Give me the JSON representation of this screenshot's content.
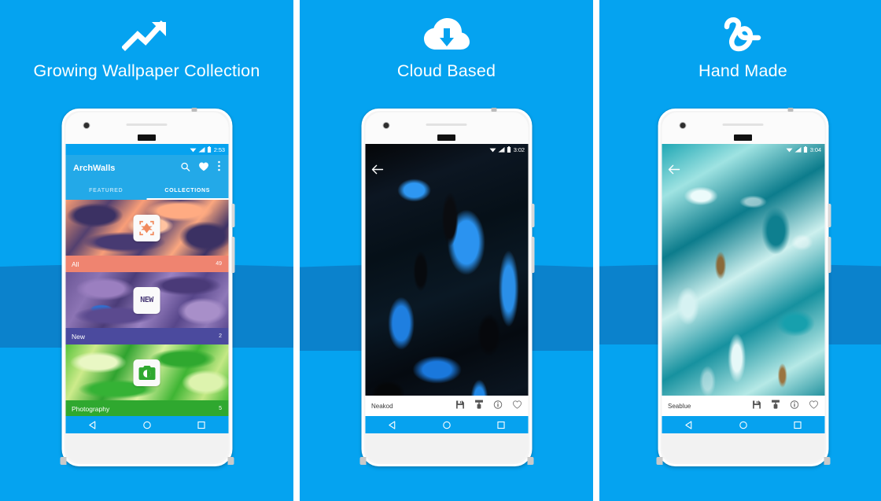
{
  "theme": {
    "background_blue": "#05a3f0",
    "wave_blue": "#0b82cc",
    "appbar_blue": "#23a9e8",
    "navbar_blue": "#06a2ef",
    "headline_color": "#ffffff"
  },
  "panels": [
    {
      "id": "panel-growing-collection",
      "icon": "trending-up-icon",
      "headline": "Growing Wallpaper Collection",
      "phone": {
        "statusbar": {
          "time": "2:53",
          "icons": [
            "wifi-icon",
            "signal-icon",
            "battery-icon"
          ]
        },
        "appbar": {
          "title": "ArchWalls",
          "icons": [
            "search-icon",
            "heart-icon",
            "overflow-menu-icon"
          ]
        },
        "tabs": [
          {
            "label": "FEATURED",
            "active": false
          },
          {
            "label": "COLLECTIONS",
            "active": true
          }
        ],
        "collections": [
          {
            "name": "All",
            "count": "49",
            "art": "art-orange",
            "badge_icon": "collection-all-icon",
            "label_color": "#ef8470"
          },
          {
            "name": "New",
            "count": "2",
            "art": "art-purple",
            "badge_icon": "new-badge-icon",
            "badge_text": "NEW",
            "label_color": "#4b4a9e"
          },
          {
            "name": "Photography",
            "count": "5",
            "art": "art-green",
            "badge_icon": "camera-icon",
            "label_color": "#2fa82f"
          }
        ],
        "navbar": [
          "back-nav-icon",
          "home-nav-icon",
          "recents-nav-icon"
        ]
      }
    },
    {
      "id": "panel-cloud-based",
      "icon": "cloud-download-icon",
      "headline": "Cloud Based",
      "phone": {
        "statusbar": {
          "time": "3:02",
          "icons": [
            "wifi-icon",
            "signal-icon",
            "battery-icon"
          ]
        },
        "back_icon": "back-arrow-icon",
        "wallpaper_art": "art-blackblue",
        "detail": {
          "name": "Neakod",
          "icons": [
            "save-icon",
            "apply-wallpaper-icon",
            "info-icon",
            "favorite-icon"
          ]
        },
        "navbar": [
          "back-nav-icon",
          "home-nav-icon",
          "recents-nav-icon"
        ]
      }
    },
    {
      "id": "panel-hand-made",
      "icon": "hand-drawn-squiggle-icon",
      "headline": "Hand Made",
      "phone": {
        "statusbar": {
          "time": "3:04",
          "icons": [
            "wifi-icon",
            "signal-icon",
            "battery-icon"
          ]
        },
        "back_icon": "back-arrow-icon",
        "wallpaper_art": "art-teal",
        "detail": {
          "name": "Seablue",
          "icons": [
            "save-icon",
            "apply-wallpaper-icon",
            "info-icon",
            "favorite-icon"
          ]
        },
        "navbar": [
          "back-nav-icon",
          "home-nav-icon",
          "recents-nav-icon"
        ]
      }
    }
  ]
}
